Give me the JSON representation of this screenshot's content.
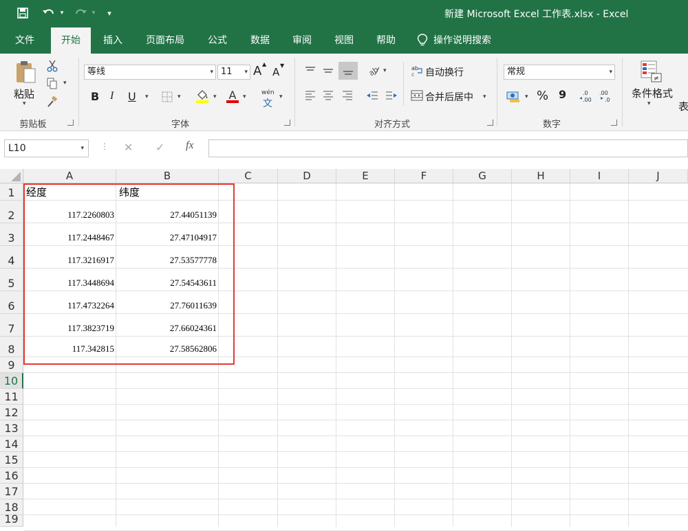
{
  "window": {
    "title": "新建 Microsoft Excel 工作表.xlsx  -  Excel"
  },
  "tabs": [
    "文件",
    "开始",
    "插入",
    "页面布局",
    "公式",
    "数据",
    "审阅",
    "视图",
    "帮助"
  ],
  "tell_me": "操作说明搜索",
  "ribbon": {
    "clipboard": {
      "paste": "粘贴",
      "label": "剪贴板"
    },
    "font": {
      "name": "等线",
      "size": "11",
      "grow": "A",
      "shrink": "A",
      "bold": "B",
      "italic": "I",
      "underline": "U",
      "label": "字体",
      "phonetic_top": "wén",
      "phonetic_bottom": "文"
    },
    "alignment": {
      "wrap": "自动换行",
      "merge": "合并后居中",
      "label": "对齐方式"
    },
    "number": {
      "format": "常规",
      "percent": "%",
      "comma": "9",
      "label": "数字"
    },
    "styles": {
      "conditional": "条件格式",
      "partial": "表"
    }
  },
  "formula_bar": {
    "name_box": "L10",
    "fx": "fx",
    "cancel": "✕",
    "enter": "✓",
    "value": ""
  },
  "colors": {
    "accent": "#217346",
    "highlight_red": "#e53935",
    "font_red": "#e00000",
    "fill_yellow": "#ffff00"
  },
  "columns": [
    "A",
    "B",
    "C",
    "D",
    "E",
    "F",
    "G",
    "H",
    "I",
    "J"
  ],
  "rows": [
    "1",
    "2",
    "3",
    "4",
    "5",
    "6",
    "7",
    "8",
    "9",
    "10",
    "11",
    "12",
    "13",
    "14",
    "15",
    "16",
    "17",
    "18",
    "19"
  ],
  "selected_row": "10",
  "sheet": {
    "headers": [
      "经度",
      "纬度"
    ],
    "data": [
      [
        "117.2260803",
        "27.44051139"
      ],
      [
        "117.2448467",
        "27.47104917"
      ],
      [
        "117.3216917",
        "27.53577778"
      ],
      [
        "117.3448694",
        "27.54543611"
      ],
      [
        "117.4732264",
        "27.76011639"
      ],
      [
        "117.3823719",
        "27.66024361"
      ],
      [
        "117.342815",
        "27.58562806"
      ]
    ]
  }
}
